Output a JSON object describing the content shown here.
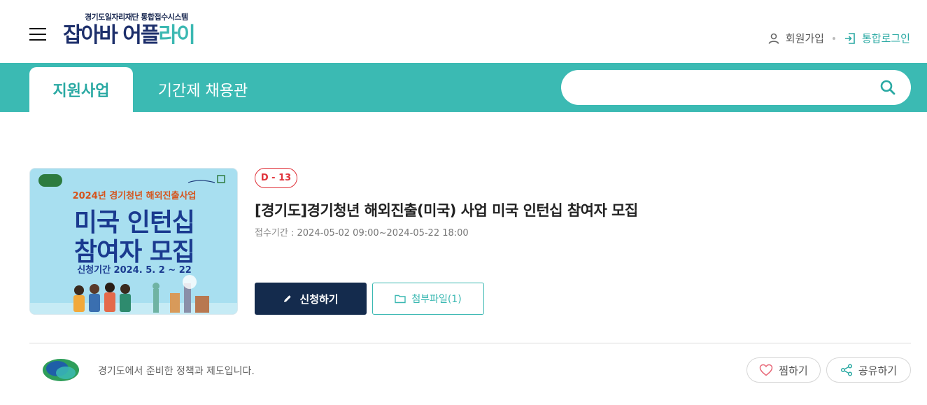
{
  "header": {
    "logo_sub": "경기도일자리재단 통합접수시스템",
    "logo_part1": "잡아바",
    "logo_part2_a": "어플",
    "logo_part2_b": "라이",
    "signup_label": "회원가입",
    "login_label": "통합로그인"
  },
  "nav": {
    "tabs": [
      {
        "label": "지원사업",
        "active": true
      },
      {
        "label": "기간제 채용관",
        "active": false
      }
    ],
    "search_value": ""
  },
  "card": {
    "thumbnail": {
      "subtitle": "2024년 경기청년 해외진출사업",
      "line1": "미국 인턴십",
      "line2": "참여자 모집",
      "date": "신청기간 2024. 5. 2 ~ 22"
    },
    "dday": "D - 13",
    "title": "[경기도]경기청년 해외진출(미국) 사업 미국 인턴십 참여자 모집",
    "period_label": "접수기간 :",
    "period_value": "2024-05-02 09:00~2024-05-22 18:00",
    "apply_label": "신청하기",
    "attach_label": "첨부파일(1)"
  },
  "footer": {
    "org_text": "경기도에서 준비한 정책과 제도입니다.",
    "like_label": "찜하기",
    "share_label": "공유하기"
  },
  "colors": {
    "teal": "#3bbab3",
    "navy": "#142b4d",
    "dday_red": "#e0323a"
  }
}
